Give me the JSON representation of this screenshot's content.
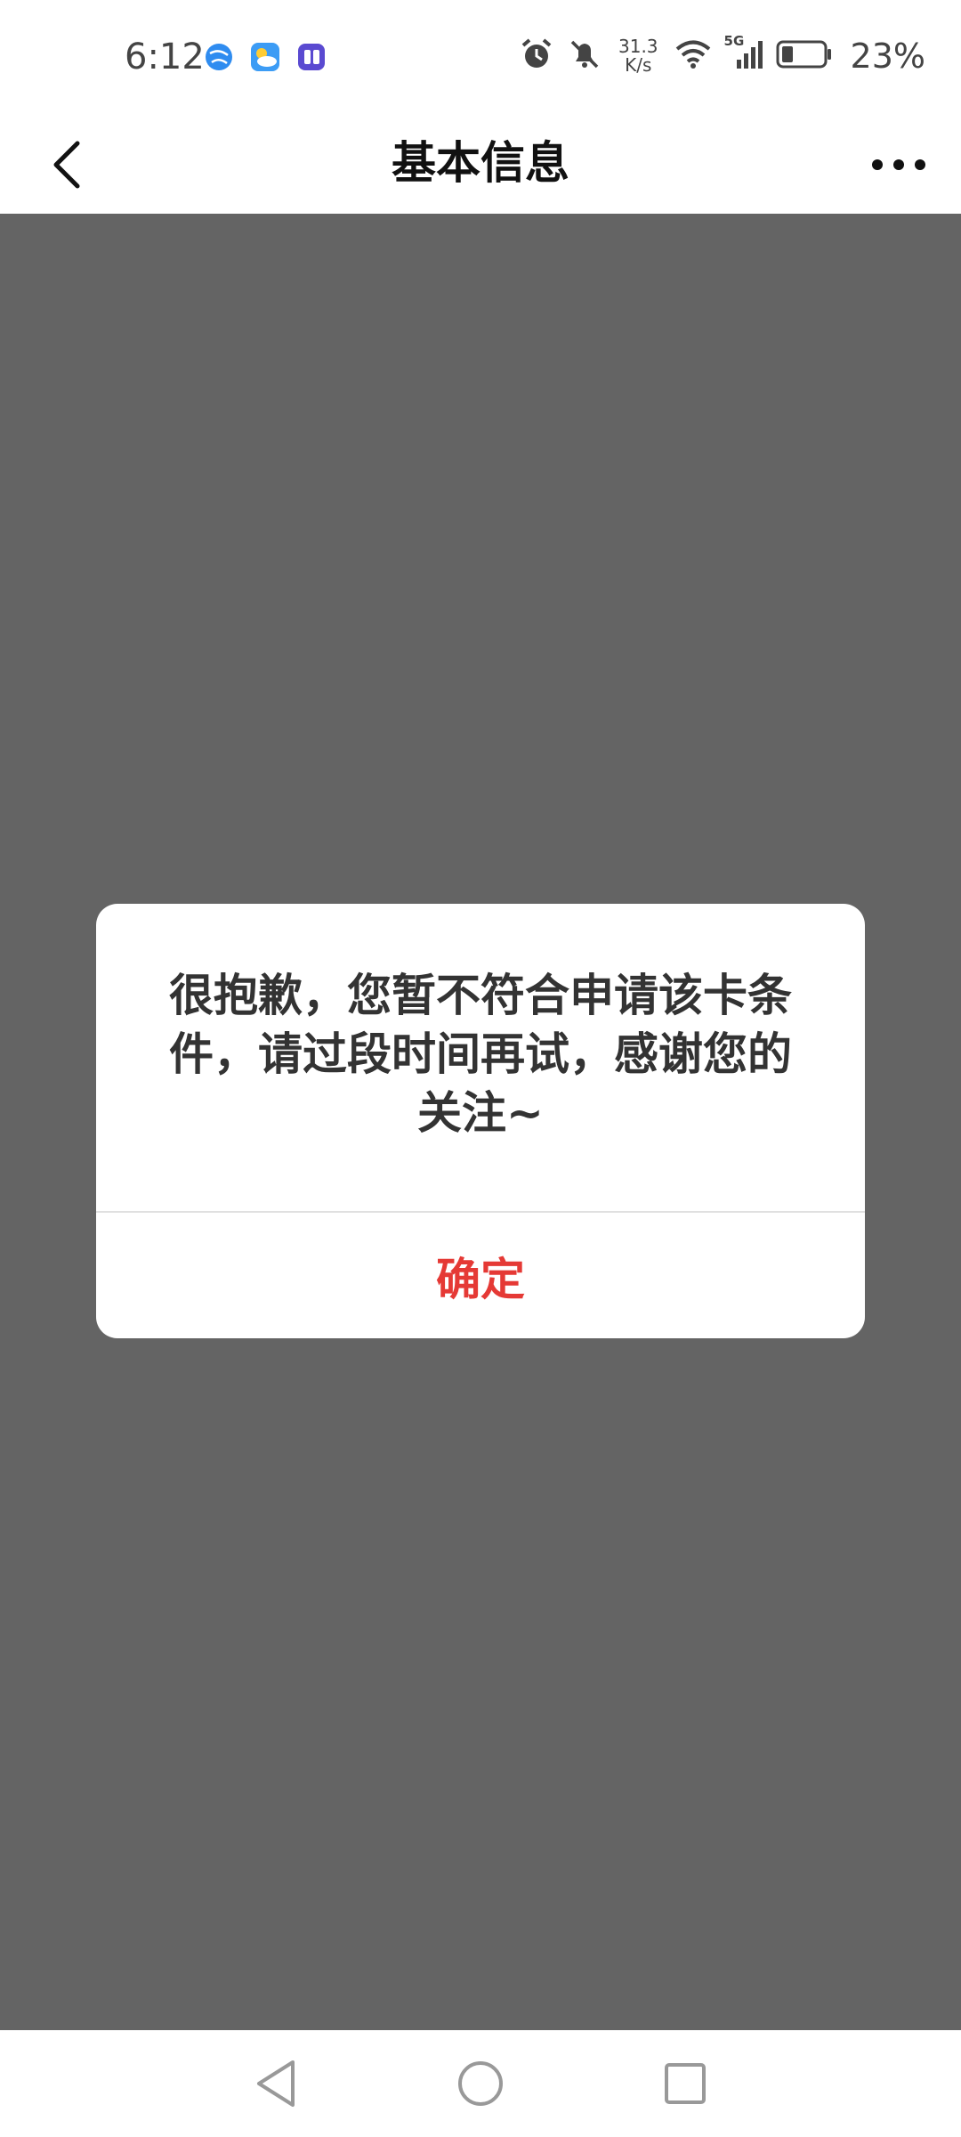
{
  "status_bar": {
    "time": "6:12",
    "net_speed_value": "31.3",
    "net_speed_unit": "K/s",
    "network_type": "5G",
    "battery_percent": "23%",
    "app_icons": [
      "browser-icon",
      "weather-icon",
      "tieba-icon"
    ]
  },
  "header": {
    "title": "基本信息"
  },
  "dialog": {
    "message": "很抱歉，您暂不符合申请该卡条件，请过段时间再试，感谢您的关注~",
    "confirm_label": "确定",
    "confirm_color": "#e53935"
  },
  "colors": {
    "overlay": "#646464",
    "accent": "#e53935"
  }
}
